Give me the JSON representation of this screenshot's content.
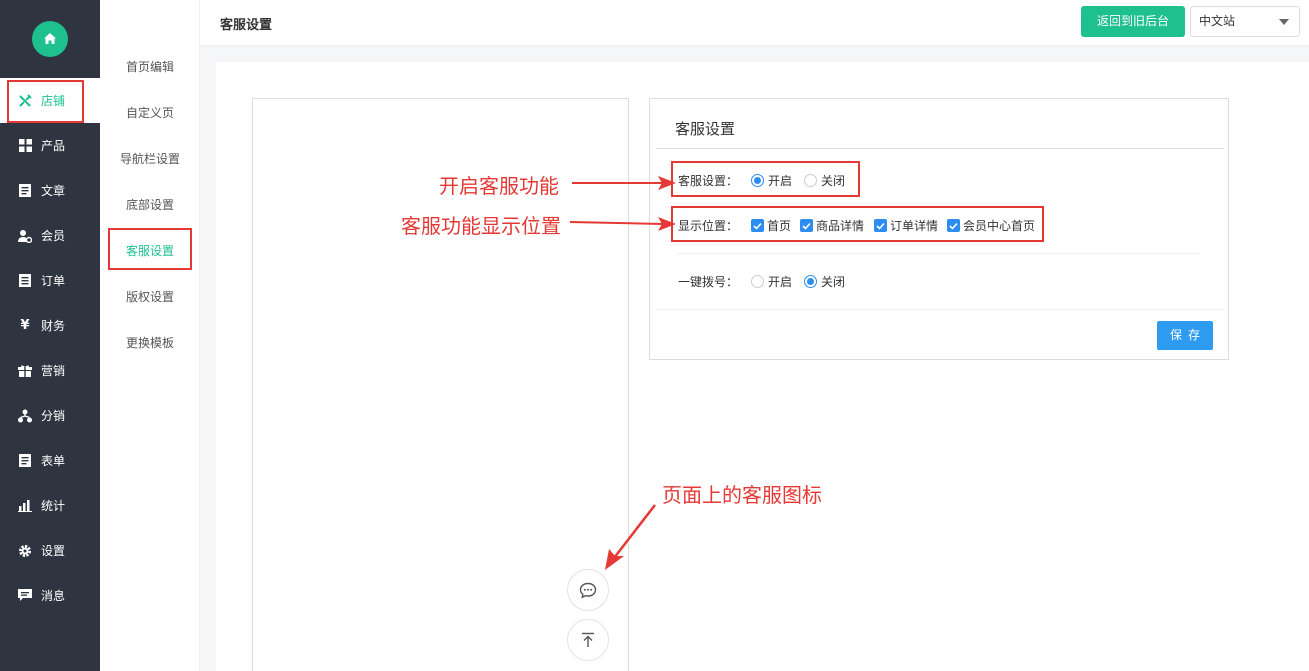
{
  "sidebar": {
    "items": [
      {
        "label": "店铺",
        "icon": "tools-icon"
      },
      {
        "label": "产品",
        "icon": "grid-icon"
      },
      {
        "label": "文章",
        "icon": "document-icon"
      },
      {
        "label": "会员",
        "icon": "user-icon"
      },
      {
        "label": "订单",
        "icon": "order-icon"
      },
      {
        "label": "财务",
        "icon": "yen-icon"
      },
      {
        "label": "营销",
        "icon": "gift-icon"
      },
      {
        "label": "分销",
        "icon": "hierarchy-icon"
      },
      {
        "label": "表单",
        "icon": "form-icon"
      },
      {
        "label": "统计",
        "icon": "chart-icon"
      },
      {
        "label": "设置",
        "icon": "gear-icon"
      },
      {
        "label": "消息",
        "icon": "message-icon"
      }
    ]
  },
  "subnav": {
    "items": [
      "首页编辑",
      "自定义页",
      "导航栏设置",
      "底部设置",
      "客服设置",
      "版权设置",
      "更换模板"
    ]
  },
  "header": {
    "title": "客服设置",
    "back_label": "返回到旧后台",
    "language": "中文站"
  },
  "panel": {
    "title": "客服设置",
    "service": {
      "label": "客服设置：",
      "options": [
        "开启",
        "关闭"
      ],
      "selected": "开启"
    },
    "display": {
      "label": "显示位置：",
      "options": [
        "首页",
        "商品详情",
        "订单详情",
        "会员中心首页"
      ]
    },
    "dial": {
      "label": "一键拨号：",
      "options": [
        "开启",
        "关闭"
      ],
      "selected": "关闭"
    },
    "save_label": "保存"
  },
  "annotations": {
    "enable": "开启客服功能",
    "position": "客服功能显示位置",
    "icon": "页面上的客服图标"
  },
  "colors": {
    "accent": "#1ec08e",
    "primary": "#2d8cf0",
    "annotation": "#e53935",
    "sidebar": "#2f3540"
  }
}
